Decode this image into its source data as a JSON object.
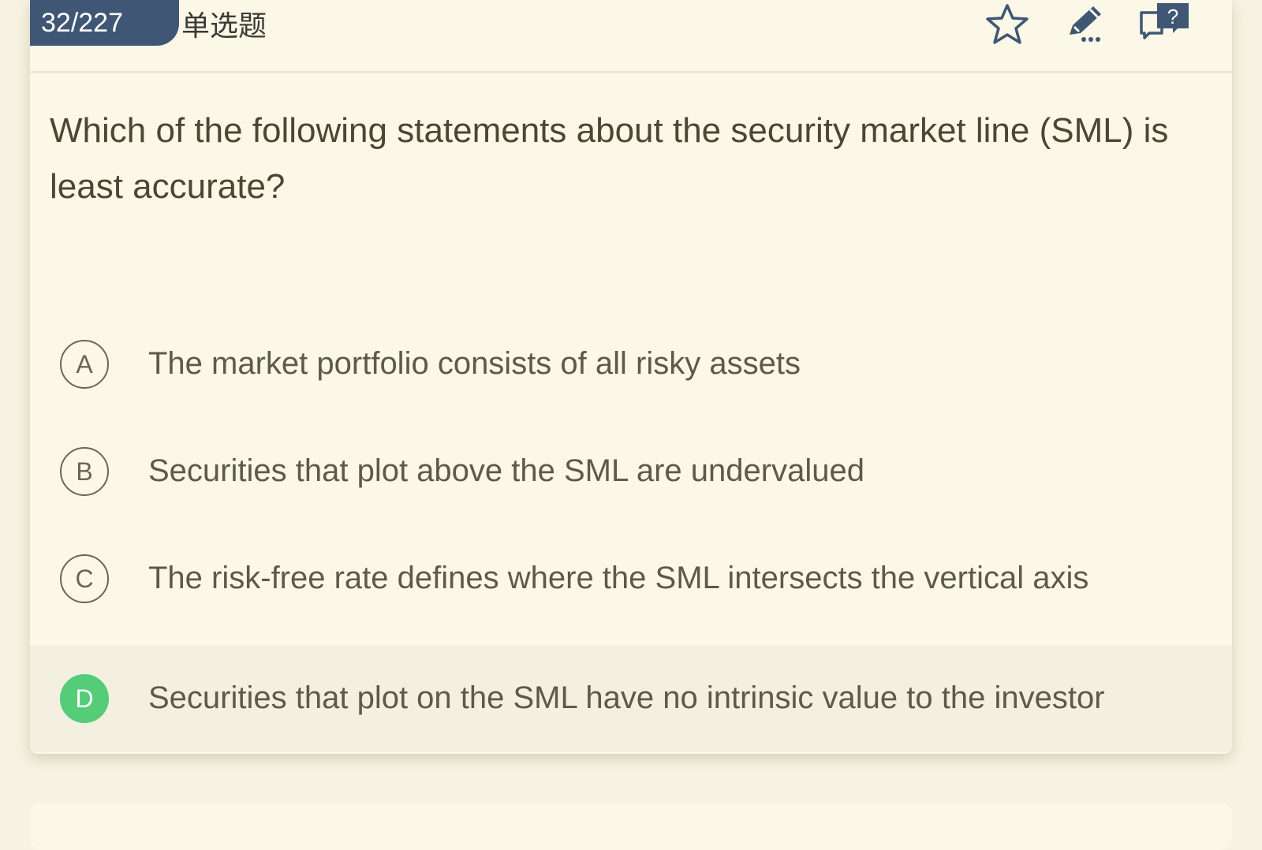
{
  "header": {
    "counter": "32/227",
    "question_type": "单选题",
    "icons": [
      "star-icon",
      "edit-note-icon",
      "feedback-help-icon"
    ]
  },
  "question": {
    "text": "Which of the following statements about the security market line (SML) is least accurate?"
  },
  "options": [
    {
      "letter": "A",
      "text": "The market portfolio consists of all risky assets",
      "selected": false
    },
    {
      "letter": "B",
      "text": "Securities that plot above the SML are undervalued",
      "selected": false
    },
    {
      "letter": "C",
      "text": "The risk-free rate defines where the SML intersects the vertical axis",
      "selected": false
    },
    {
      "letter": "D",
      "text": "Securities that plot on the SML have no intrinsic value to the investor",
      "selected": true
    }
  ],
  "colors": {
    "background": "#f7f3e2",
    "card": "#fbf8e8",
    "counter_bg": "#3f5774",
    "correct": "#55cc77",
    "text": "#4a4733"
  }
}
